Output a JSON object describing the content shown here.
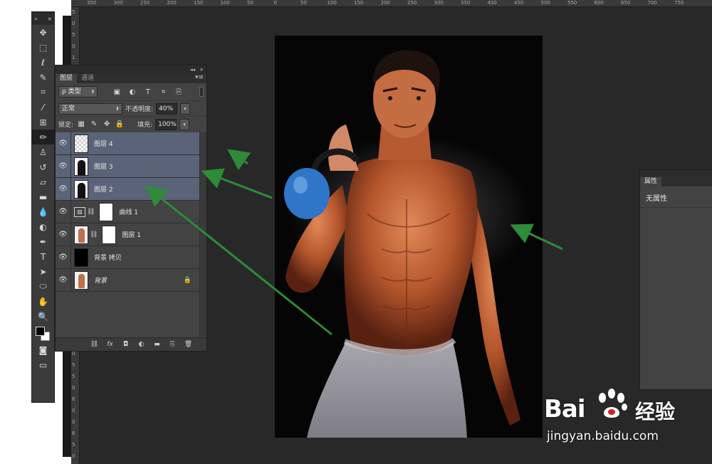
{
  "ruler_top": [
    "350",
    "300",
    "250",
    "200",
    "150",
    "100",
    "50",
    "0",
    "50",
    "100",
    "150",
    "200",
    "250",
    "300",
    "350",
    "400",
    "450",
    "500",
    "550",
    "600",
    "650",
    "700",
    "750"
  ],
  "ruler_left": [
    "5",
    "0",
    "5",
    "0",
    "1",
    "0",
    "0",
    "1",
    "5",
    "0",
    "2",
    "0",
    "0",
    "2",
    "5",
    "0",
    "3",
    "0",
    "0",
    "3",
    "5",
    "0",
    "4",
    "0",
    "0",
    "4",
    "5",
    "0",
    "5",
    "0",
    "0",
    "5",
    "5",
    "0",
    "6",
    "0",
    "0",
    "6",
    "5",
    "0"
  ],
  "tools_panel": {
    "collapse_glyph": "»",
    "close_glyph": "×",
    "tools": [
      {
        "name": "move-tool",
        "glyph": "✥"
      },
      {
        "name": "marquee-tool",
        "glyph": "⬚"
      },
      {
        "name": "lasso-tool",
        "glyph": "ℓ"
      },
      {
        "name": "quick-select-tool",
        "glyph": "✎"
      },
      {
        "name": "crop-tool",
        "glyph": "⌗"
      },
      {
        "name": "eyedropper-tool",
        "glyph": "⁄"
      },
      {
        "name": "healing-brush-tool",
        "glyph": "⊞"
      },
      {
        "name": "brush-tool",
        "glyph": "✏"
      },
      {
        "name": "clone-stamp-tool",
        "glyph": "♙"
      },
      {
        "name": "history-brush-tool",
        "glyph": "↺"
      },
      {
        "name": "eraser-tool",
        "glyph": "▱"
      },
      {
        "name": "gradient-tool",
        "glyph": "▬"
      },
      {
        "name": "blur-tool",
        "glyph": "💧"
      },
      {
        "name": "dodge-tool",
        "glyph": "◐"
      },
      {
        "name": "pen-tool",
        "glyph": "✒"
      },
      {
        "name": "type-tool",
        "glyph": "T"
      },
      {
        "name": "path-select-tool",
        "glyph": "➤"
      },
      {
        "name": "ellipse-tool",
        "glyph": "⬭"
      },
      {
        "name": "hand-tool",
        "glyph": "✋"
      },
      {
        "name": "zoom-tool",
        "glyph": "🔍"
      }
    ],
    "active_tool": "brush-tool",
    "quick_mask_glyph": "◙",
    "screen_mode_glyph": "▭"
  },
  "layers_panel": {
    "top_glyphs": {
      "collapse": "◂◂",
      "close": "×"
    },
    "tabs": [
      "图层",
      "通道"
    ],
    "active_tab": "图层",
    "menu_glyph": "▾≡",
    "filter": {
      "label": "ρ 类型",
      "caret": "⬍"
    },
    "filter_icons": [
      "▣",
      "◐",
      "T",
      "⌗",
      "⎘"
    ],
    "blend_mode": "正常",
    "opacity_label": "不透明度:",
    "opacity_value": "40%",
    "lock_label": "锁定:",
    "lock_icons": [
      "▦",
      "✎",
      "✥",
      "🔒"
    ],
    "fill_label": "填充:",
    "fill_value": "100%",
    "eye_glyph": "👁",
    "layers": [
      {
        "name": "图层 4",
        "thumb": "checker",
        "selected": true
      },
      {
        "name": "图层 3",
        "thumb": "figure",
        "selected": true
      },
      {
        "name": "图层 2",
        "thumb": "figure",
        "selected": true
      },
      {
        "name": "曲线 1",
        "thumb": "curves",
        "selected": false,
        "adj_glyph": "▨"
      },
      {
        "name": "图层 1",
        "thumb": "photo-mask",
        "selected": false
      },
      {
        "name": "背景 拷贝",
        "thumb": "black",
        "selected": false
      },
      {
        "name": "背景",
        "thumb": "photo",
        "selected": false,
        "locked": true
      }
    ],
    "chain_glyph": "⛓",
    "lock_glyph": "🔒",
    "bottom_icons": [
      "⛓",
      "fx",
      "◘",
      "◐",
      "▬",
      "⎘",
      "🗑"
    ]
  },
  "properties_panel": {
    "tab": "属性",
    "text": "无属性"
  },
  "watermark": {
    "logo_left": "Bai",
    "logo_right": "经验",
    "url": "jingyan.baidu.com"
  },
  "colors": {
    "accent_selected": "#5a6378",
    "arrow_green": "#2e8b3a"
  }
}
